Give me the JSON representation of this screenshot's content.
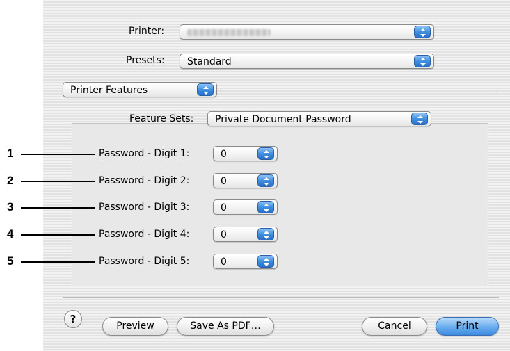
{
  "dialog": {
    "printer_label": "Printer:",
    "printer_value": "",
    "presets_label": "Presets:",
    "presets_value": "Standard",
    "section_value": "Printer Features",
    "feature_sets_label": "Feature Sets:",
    "feature_sets_value": "Private Document Password",
    "digits": [
      {
        "callout": "1",
        "label": "Password - Digit 1:",
        "value": "0"
      },
      {
        "callout": "2",
        "label": "Password - Digit 2:",
        "value": "0"
      },
      {
        "callout": "3",
        "label": "Password - Digit 3:",
        "value": "0"
      },
      {
        "callout": "4",
        "label": "Password - Digit 4:",
        "value": "0"
      },
      {
        "callout": "5",
        "label": "Password - Digit 5:",
        "value": "0"
      }
    ],
    "buttons": {
      "help": "?",
      "preview": "Preview",
      "save_pdf": "Save As PDF…",
      "cancel": "Cancel",
      "print": "Print"
    }
  },
  "colors": {
    "stepper_blue": "#3f8fe0",
    "primary_button": "#6fb0ef"
  }
}
